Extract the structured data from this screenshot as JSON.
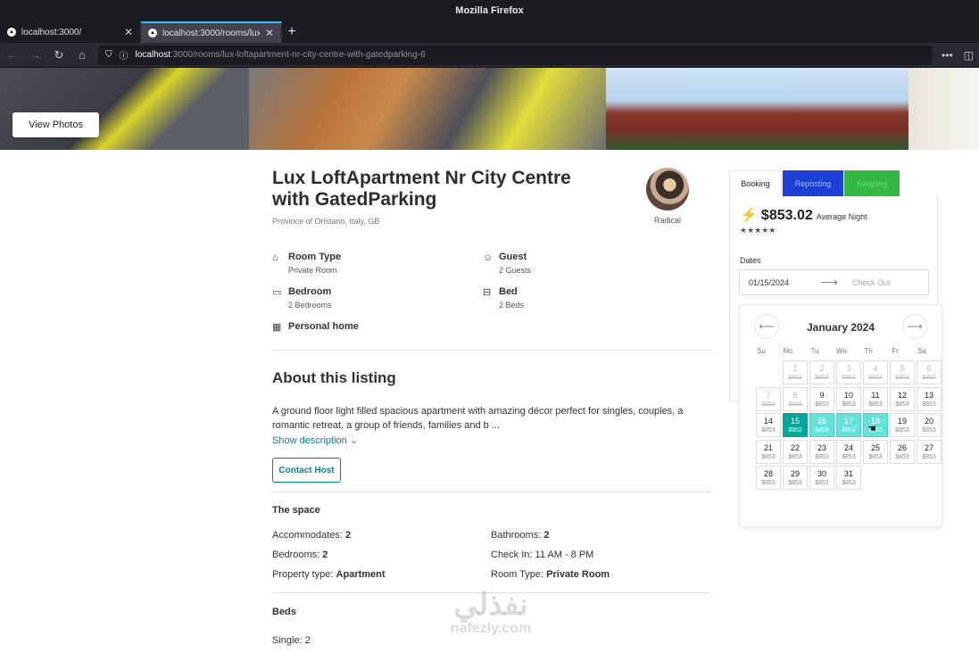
{
  "browser": {
    "window_title": "Mozilla Firefox",
    "tabs": [
      {
        "label": "localhost:3000/",
        "active": false
      },
      {
        "label": "localhost:3000/rooms/lux",
        "active": true
      }
    ],
    "url_host": "localhost",
    "url_rest": ":3000/rooms/lux-loftapartment-nr-city-centre-with-gatedparking-6"
  },
  "hero": {
    "view_photos": "View Photos"
  },
  "listing": {
    "title": "Lux LoftApartment Nr City Centre with GatedParking",
    "location": "Province of Oristano, Italy, GB",
    "host_name": "Radical",
    "features": [
      {
        "icon": "home-icon",
        "label": "Room Type",
        "value": "Private Room"
      },
      {
        "icon": "guest-icon",
        "label": "Guest",
        "value": "2 Guests"
      },
      {
        "icon": "bedroom-icon",
        "label": "Bedroom",
        "value": "2 Bedrooms"
      },
      {
        "icon": "bed-icon",
        "label": "Bed",
        "value": "2 Beds"
      },
      {
        "icon": "building-icon",
        "label": "Personal home",
        "value": ""
      }
    ],
    "about_title": "About this listing",
    "description": "A ground floor light filled spacious apartment with amazing décor perfect for singles, couples, a romantic retreat, a group of friends, families and b ...",
    "show_description": "Show description",
    "contact_host": "Contact Host",
    "space_title": "The space",
    "space": {
      "accommodates_label": "Accommodates:",
      "accommodates": "2",
      "bathrooms_label": "Bathrooms:",
      "bathrooms": "2",
      "bedrooms_label": "Bedrooms:",
      "bedrooms": "2",
      "checkin_label": "Check In:",
      "checkin": "11 AM - 8 PM",
      "property_label": "Property type:",
      "property": "Apartment",
      "roomtype_label": "Room Type:",
      "roomtype": "Private Room"
    },
    "beds_title": "Beds",
    "single_label": "Single:",
    "single": "2"
  },
  "booking": {
    "tabs": [
      "Booking",
      "Reposting",
      "Swaping"
    ],
    "price": "$853.02",
    "price_unit": "Average Night",
    "stars": "★★★★★",
    "dates_label": "Dates",
    "check_in": "01/15/2024",
    "check_out_placeholder": "Check Out"
  },
  "calendar": {
    "month": "January 2024",
    "weekdays": [
      "Su",
      "Mo",
      "Tu",
      "We",
      "Th",
      "Fr",
      "Sa"
    ],
    "price": "$853",
    "first_weekday_index": 1,
    "days_in_month": 31,
    "past_until": 8,
    "selected_start": 15,
    "range_end": 18
  },
  "colors": {
    "accent": "#00a699",
    "range": "#66e2da",
    "link": "#008489",
    "reposting": "#1e3fd6",
    "swaping": "#32b843"
  },
  "watermark": {
    "arabic": "نفذلي",
    "latin": "nafezly.com"
  }
}
